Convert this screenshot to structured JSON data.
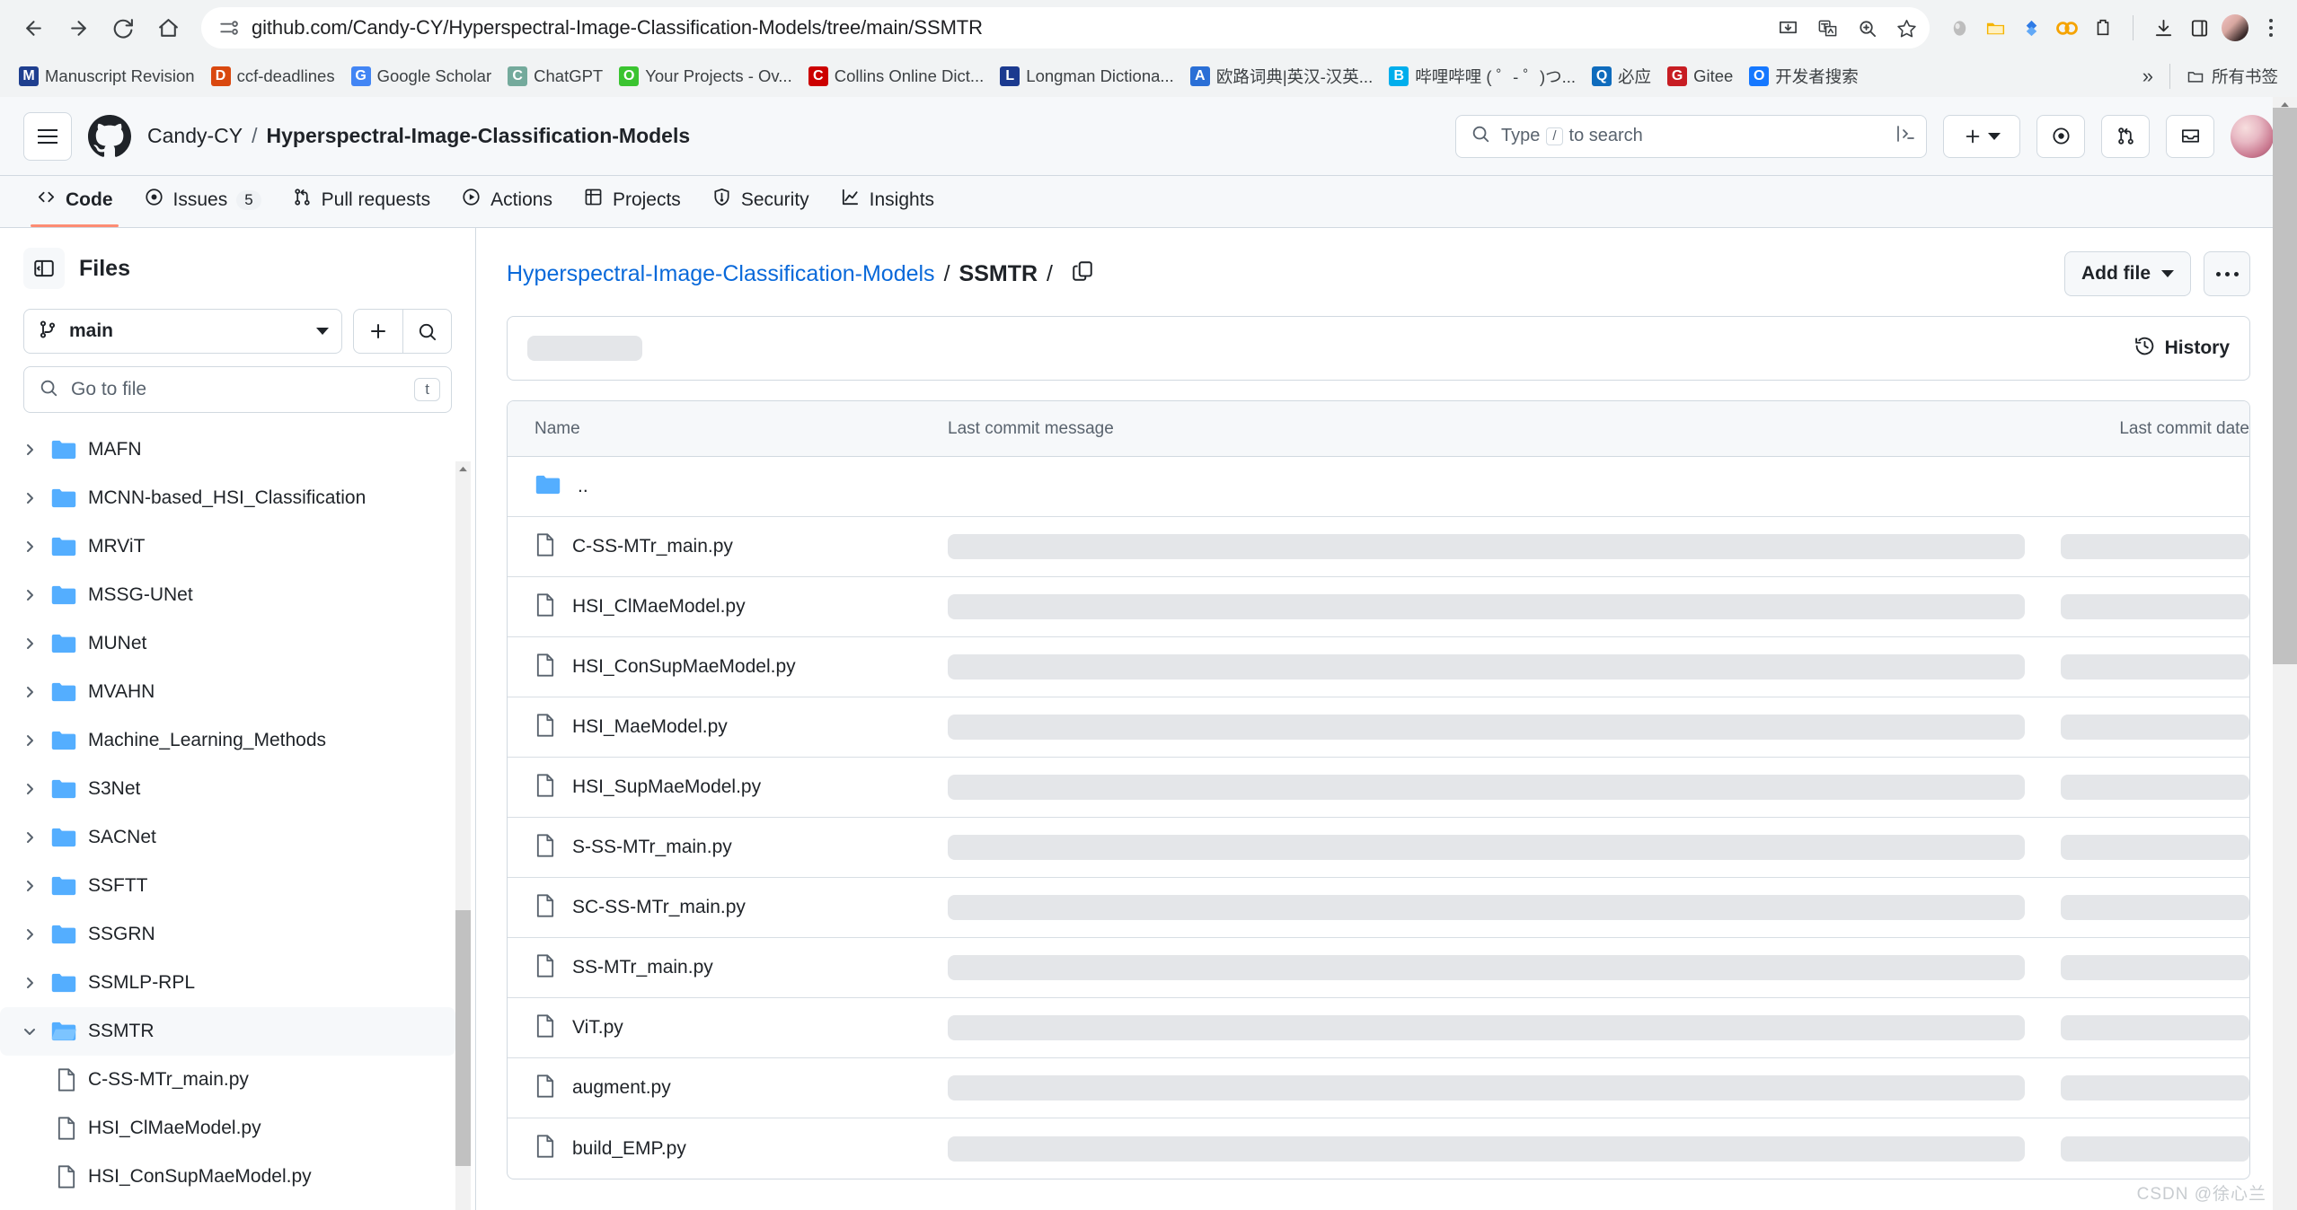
{
  "browser": {
    "url": "github.com/Candy-CY/Hyperspectral-Image-Classification-Models/tree/main/SSMTR",
    "nav": {
      "back": "back-arrow",
      "forward": "forward-arrow",
      "reload": "reload",
      "home": "home"
    },
    "bookmarks": [
      {
        "label": "Manuscript Revision",
        "icon": "M",
        "color": "#1f3f8f"
      },
      {
        "label": "ccf-deadlines",
        "icon": "D",
        "color": "#d9480f"
      },
      {
        "label": "Google Scholar",
        "icon": "G",
        "color": "#4285f4"
      },
      {
        "label": "ChatGPT",
        "icon": "C",
        "color": "#74aa9c"
      },
      {
        "label": "Your Projects - Ov...",
        "icon": "O",
        "color": "#3ac430"
      },
      {
        "label": "Collins Online Dict...",
        "icon": "C",
        "color": "#cc0000"
      },
      {
        "label": "Longman Dictiona...",
        "icon": "L",
        "color": "#1b3a8f"
      },
      {
        "label": "欧路词典|英汉-汉英...",
        "icon": "A",
        "color": "#2a6fd6"
      },
      {
        "label": "哔哩哔哩 ( ゜- ゜)つ...",
        "icon": "B",
        "color": "#00aeec"
      },
      {
        "label": "必应",
        "icon": "Q",
        "color": "#0f6cbd"
      },
      {
        "label": "Gitee",
        "icon": "G",
        "color": "#c71d23"
      },
      {
        "label": "开发者搜索",
        "icon": "O",
        "color": "#1678ff"
      }
    ],
    "bookmarks_overflow": "»",
    "all_bookmarks_label": "所有书签"
  },
  "github": {
    "owner": "Candy-CY",
    "repo": "Hyperspectral-Image-Classification-Models",
    "search_placeholder": "Type / to search",
    "search_slash_key": "/",
    "nav_tabs": [
      {
        "label": "Code",
        "icon": "code-icon",
        "active": true,
        "count": null
      },
      {
        "label": "Issues",
        "icon": "issue-opened-icon",
        "active": false,
        "count": "5"
      },
      {
        "label": "Pull requests",
        "icon": "git-pull-request-icon",
        "active": false,
        "count": null
      },
      {
        "label": "Actions",
        "icon": "play-icon",
        "active": false,
        "count": null
      },
      {
        "label": "Projects",
        "icon": "table-icon",
        "active": false,
        "count": null
      },
      {
        "label": "Security",
        "icon": "shield-icon",
        "active": false,
        "count": null
      },
      {
        "label": "Insights",
        "icon": "graph-icon",
        "active": false,
        "count": null
      }
    ]
  },
  "sidebar": {
    "title": "Files",
    "branch": "main",
    "go_to_file_placeholder": "Go to file",
    "go_to_file_key": "t",
    "tree": [
      {
        "label": "MAFN",
        "type": "folder",
        "expanded": false,
        "selected": false,
        "child": false
      },
      {
        "label": "MCNN-based_HSI_Classification",
        "type": "folder",
        "expanded": false,
        "selected": false,
        "child": false
      },
      {
        "label": "MRViT",
        "type": "folder",
        "expanded": false,
        "selected": false,
        "child": false
      },
      {
        "label": "MSSG-UNet",
        "type": "folder",
        "expanded": false,
        "selected": false,
        "child": false
      },
      {
        "label": "MUNet",
        "type": "folder",
        "expanded": false,
        "selected": false,
        "child": false
      },
      {
        "label": "MVAHN",
        "type": "folder",
        "expanded": false,
        "selected": false,
        "child": false
      },
      {
        "label": "Machine_Learning_Methods",
        "type": "folder",
        "expanded": false,
        "selected": false,
        "child": false
      },
      {
        "label": "S3Net",
        "type": "folder",
        "expanded": false,
        "selected": false,
        "child": false
      },
      {
        "label": "SACNet",
        "type": "folder",
        "expanded": false,
        "selected": false,
        "child": false
      },
      {
        "label": "SSFTT",
        "type": "folder",
        "expanded": false,
        "selected": false,
        "child": false
      },
      {
        "label": "SSGRN",
        "type": "folder",
        "expanded": false,
        "selected": false,
        "child": false
      },
      {
        "label": "SSMLP-RPL",
        "type": "folder",
        "expanded": false,
        "selected": false,
        "child": false
      },
      {
        "label": "SSMTR",
        "type": "folder",
        "expanded": true,
        "selected": true,
        "child": false
      },
      {
        "label": "C-SS-MTr_main.py",
        "type": "file",
        "expanded": false,
        "selected": false,
        "child": true
      },
      {
        "label": "HSI_ClMaeModel.py",
        "type": "file",
        "expanded": false,
        "selected": false,
        "child": true
      },
      {
        "label": "HSI_ConSupMaeModel.py",
        "type": "file",
        "expanded": false,
        "selected": false,
        "child": true
      }
    ]
  },
  "main": {
    "breadcrumb": {
      "repo": "Hyperspectral-Image-Classification-Models",
      "sep1": "/",
      "current": "SSMTR",
      "sep2": "/",
      "copy_icon": "copy-path-icon"
    },
    "add_file_label": "Add file",
    "more_options_label": "…",
    "history_label": "History",
    "table": {
      "columns": [
        "Name",
        "Last commit message",
        "Last commit date"
      ],
      "rows": [
        {
          "name": "..",
          "type": "parent",
          "msg_loading": false,
          "date_loading": false
        },
        {
          "name": "C-SS-MTr_main.py",
          "type": "file",
          "msg_loading": true,
          "date_loading": true
        },
        {
          "name": "HSI_ClMaeModel.py",
          "type": "file",
          "msg_loading": true,
          "date_loading": true
        },
        {
          "name": "HSI_ConSupMaeModel.py",
          "type": "file",
          "msg_loading": true,
          "date_loading": true
        },
        {
          "name": "HSI_MaeModel.py",
          "type": "file",
          "msg_loading": true,
          "date_loading": true
        },
        {
          "name": "HSI_SupMaeModel.py",
          "type": "file",
          "msg_loading": true,
          "date_loading": true
        },
        {
          "name": "S-SS-MTr_main.py",
          "type": "file",
          "msg_loading": true,
          "date_loading": true
        },
        {
          "name": "SC-SS-MTr_main.py",
          "type": "file",
          "msg_loading": true,
          "date_loading": true
        },
        {
          "name": "SS-MTr_main.py",
          "type": "file",
          "msg_loading": true,
          "date_loading": true
        },
        {
          "name": "ViT.py",
          "type": "file",
          "msg_loading": true,
          "date_loading": true
        },
        {
          "name": "augment.py",
          "type": "file",
          "msg_loading": true,
          "date_loading": true
        },
        {
          "name": "build_EMP.py",
          "type": "file",
          "msg_loading": true,
          "date_loading": true
        }
      ]
    }
  },
  "watermark": "CSDN @徐心兰",
  "colors": {
    "accent": "#0969da",
    "active_tab_underline": "#fd8c73",
    "folder_blue": "#54aeff",
    "border": "#d1d9e0",
    "muted_text": "#59636e"
  }
}
